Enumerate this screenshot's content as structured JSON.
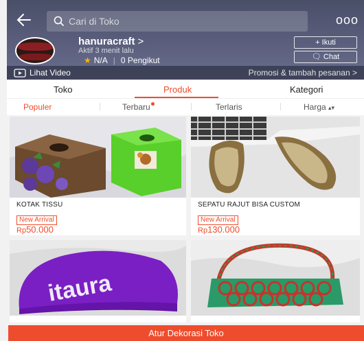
{
  "header": {
    "search_placeholder": "Cari di Toko",
    "more_glyph": "ooo",
    "shop_name": "hanuracraft",
    "shop_chevron": ">",
    "active_status": "Aktif 3 menit lalu",
    "rating": "N/A",
    "followers": "0 Pengikut",
    "follow_label": "+ Ikuti",
    "chat_label": "Chat",
    "logo_text": [
      "Hanura C",
      "Hanura C"
    ]
  },
  "videobar": {
    "video_label": "Lihat Video",
    "promo_label": "Promosi & tambah pesanan >"
  },
  "tabs": [
    {
      "label": "Toko"
    },
    {
      "label": "Produk"
    },
    {
      "label": "Kategori"
    }
  ],
  "sort": [
    {
      "label": "Populer"
    },
    {
      "label": "Terbaru"
    },
    {
      "label": "Terlaris"
    },
    {
      "label": "Harga"
    }
  ],
  "products": [
    {
      "name": "KOTAK TISSU",
      "badge": "New Arrival",
      "currency": "Rp",
      "price": "50.000"
    },
    {
      "name": "SEPATU RAJUT BISA CUSTOM",
      "badge": "New Arrival",
      "currency": "Rp",
      "price": "130.000"
    },
    {
      "name": "",
      "image_text": "itaura"
    },
    {
      "name": ""
    }
  ],
  "bottom_button": "Atur Dekorasi Toko",
  "colors": {
    "accent": "#ee4d2d",
    "header_bg": "#55597a",
    "rating_star": "#ffb400"
  }
}
